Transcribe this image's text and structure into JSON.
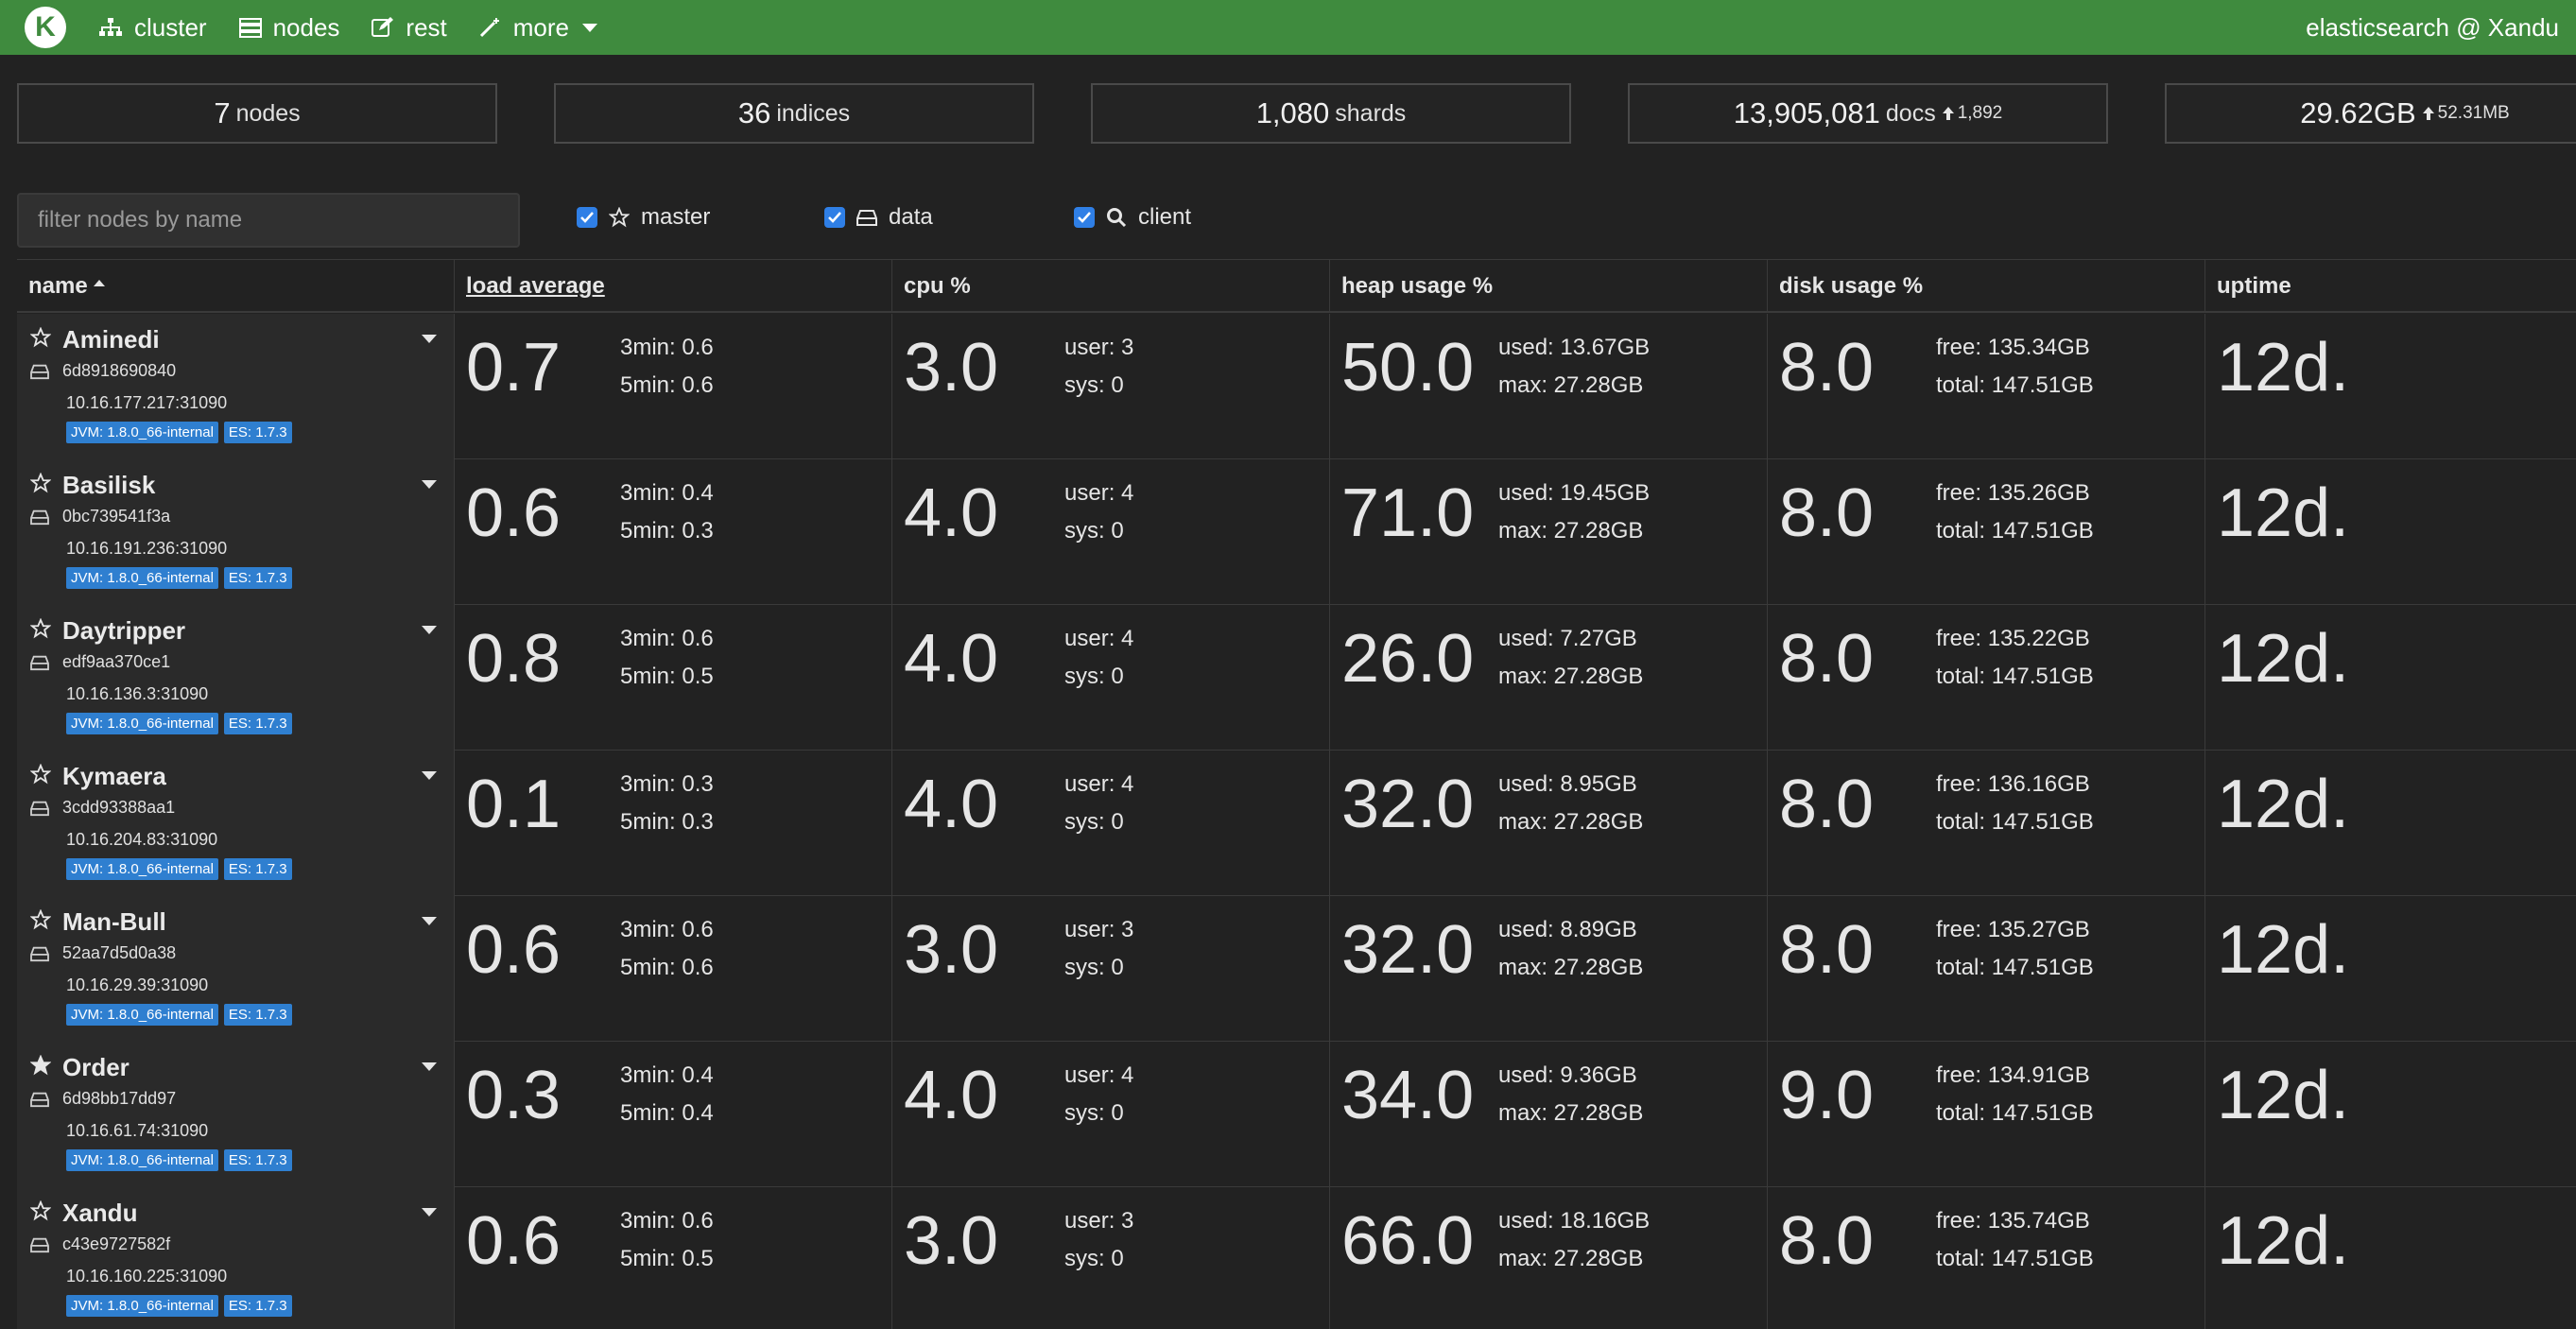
{
  "nav": {
    "logo_letter": "K",
    "items": [
      {
        "label": "cluster",
        "icon": "sitemap-icon"
      },
      {
        "label": "nodes",
        "icon": "server-icon"
      },
      {
        "label": "rest",
        "icon": "edit-icon"
      },
      {
        "label": "more",
        "icon": "magic-wand-icon"
      }
    ],
    "cluster_name": "elasticsearch @ Xandu",
    "brand_color": "#3f8b3e"
  },
  "stats": {
    "nodes": {
      "value": "7",
      "unit": "nodes"
    },
    "indices": {
      "value": "36",
      "unit": "indices"
    },
    "shards": {
      "value": "1,080",
      "unit": "shards"
    },
    "docs": {
      "value": "13,905,081",
      "unit": "docs",
      "delta": "1,892"
    },
    "size": {
      "value": "29.62GB",
      "delta": "52.31MB"
    }
  },
  "filter": {
    "placeholder": "filter nodes by name",
    "value": "",
    "master_label": "master",
    "data_label": "data",
    "client_label": "client",
    "master_checked": true,
    "data_checked": true,
    "client_checked": true
  },
  "table": {
    "headers": {
      "name": "name",
      "load": "load average",
      "cpu": "cpu %",
      "heap": "heap usage %",
      "disk": "disk usage %",
      "uptime": "uptime"
    },
    "rows": [
      {
        "name": "Aminedi",
        "master": false,
        "id": "6d8918690840",
        "address": "10.16.177.217:31090",
        "jvm": "JVM: 1.8.0_66-internal",
        "es": "ES: 1.7.3",
        "load": "0.7",
        "load3": "3min: 0.6",
        "load5": "5min: 0.6",
        "cpu": "3.0",
        "user": "user: 3",
        "sys": "sys: 0",
        "heap": "50.0",
        "heap_used": "used: 13.67GB",
        "heap_max": "max: 27.28GB",
        "disk": "8.0",
        "disk_free": "free: 135.34GB",
        "disk_total": "total: 147.51GB",
        "uptime": "12d."
      },
      {
        "name": "Basilisk",
        "master": false,
        "id": "0bc739541f3a",
        "address": "10.16.191.236:31090",
        "jvm": "JVM: 1.8.0_66-internal",
        "es": "ES: 1.7.3",
        "load": "0.6",
        "load3": "3min: 0.4",
        "load5": "5min: 0.3",
        "cpu": "4.0",
        "user": "user: 4",
        "sys": "sys: 0",
        "heap": "71.0",
        "heap_used": "used: 19.45GB",
        "heap_max": "max: 27.28GB",
        "disk": "8.0",
        "disk_free": "free: 135.26GB",
        "disk_total": "total: 147.51GB",
        "uptime": "12d."
      },
      {
        "name": "Daytripper",
        "master": false,
        "id": "edf9aa370ce1",
        "address": "10.16.136.3:31090",
        "jvm": "JVM: 1.8.0_66-internal",
        "es": "ES: 1.7.3",
        "load": "0.8",
        "load3": "3min: 0.6",
        "load5": "5min: 0.5",
        "cpu": "4.0",
        "user": "user: 4",
        "sys": "sys: 0",
        "heap": "26.0",
        "heap_used": "used: 7.27GB",
        "heap_max": "max: 27.28GB",
        "disk": "8.0",
        "disk_free": "free: 135.22GB",
        "disk_total": "total: 147.51GB",
        "uptime": "12d."
      },
      {
        "name": "Kymaera",
        "master": false,
        "id": "3cdd93388aa1",
        "address": "10.16.204.83:31090",
        "jvm": "JVM: 1.8.0_66-internal",
        "es": "ES: 1.7.3",
        "load": "0.1",
        "load3": "3min: 0.3",
        "load5": "5min: 0.3",
        "cpu": "4.0",
        "user": "user: 4",
        "sys": "sys: 0",
        "heap": "32.0",
        "heap_used": "used: 8.95GB",
        "heap_max": "max: 27.28GB",
        "disk": "8.0",
        "disk_free": "free: 136.16GB",
        "disk_total": "total: 147.51GB",
        "uptime": "12d."
      },
      {
        "name": "Man-Bull",
        "master": false,
        "id": "52aa7d5d0a38",
        "address": "10.16.29.39:31090",
        "jvm": "JVM: 1.8.0_66-internal",
        "es": "ES: 1.7.3",
        "load": "0.6",
        "load3": "3min: 0.6",
        "load5": "5min: 0.6",
        "cpu": "3.0",
        "user": "user: 3",
        "sys": "sys: 0",
        "heap": "32.0",
        "heap_used": "used: 8.89GB",
        "heap_max": "max: 27.28GB",
        "disk": "8.0",
        "disk_free": "free: 135.27GB",
        "disk_total": "total: 147.51GB",
        "uptime": "12d."
      },
      {
        "name": "Order",
        "master": true,
        "id": "6d98bb17dd97",
        "address": "10.16.61.74:31090",
        "jvm": "JVM: 1.8.0_66-internal",
        "es": "ES: 1.7.3",
        "load": "0.3",
        "load3": "3min: 0.4",
        "load5": "5min: 0.4",
        "cpu": "4.0",
        "user": "user: 4",
        "sys": "sys: 0",
        "heap": "34.0",
        "heap_used": "used: 9.36GB",
        "heap_max": "max: 27.28GB",
        "disk": "9.0",
        "disk_free": "free: 134.91GB",
        "disk_total": "total: 147.51GB",
        "uptime": "12d."
      },
      {
        "name": "Xandu",
        "master": false,
        "id": "c43e9727582f",
        "address": "10.16.160.225:31090",
        "jvm": "JVM: 1.8.0_66-internal",
        "es": "ES: 1.7.3",
        "load": "0.6",
        "load3": "3min: 0.6",
        "load5": "5min: 0.5",
        "cpu": "3.0",
        "user": "user: 3",
        "sys": "sys: 0",
        "heap": "66.0",
        "heap_used": "used: 18.16GB",
        "heap_max": "max: 27.28GB",
        "disk": "8.0",
        "disk_free": "free: 135.74GB",
        "disk_total": "total: 147.51GB",
        "uptime": "12d."
      }
    ]
  }
}
